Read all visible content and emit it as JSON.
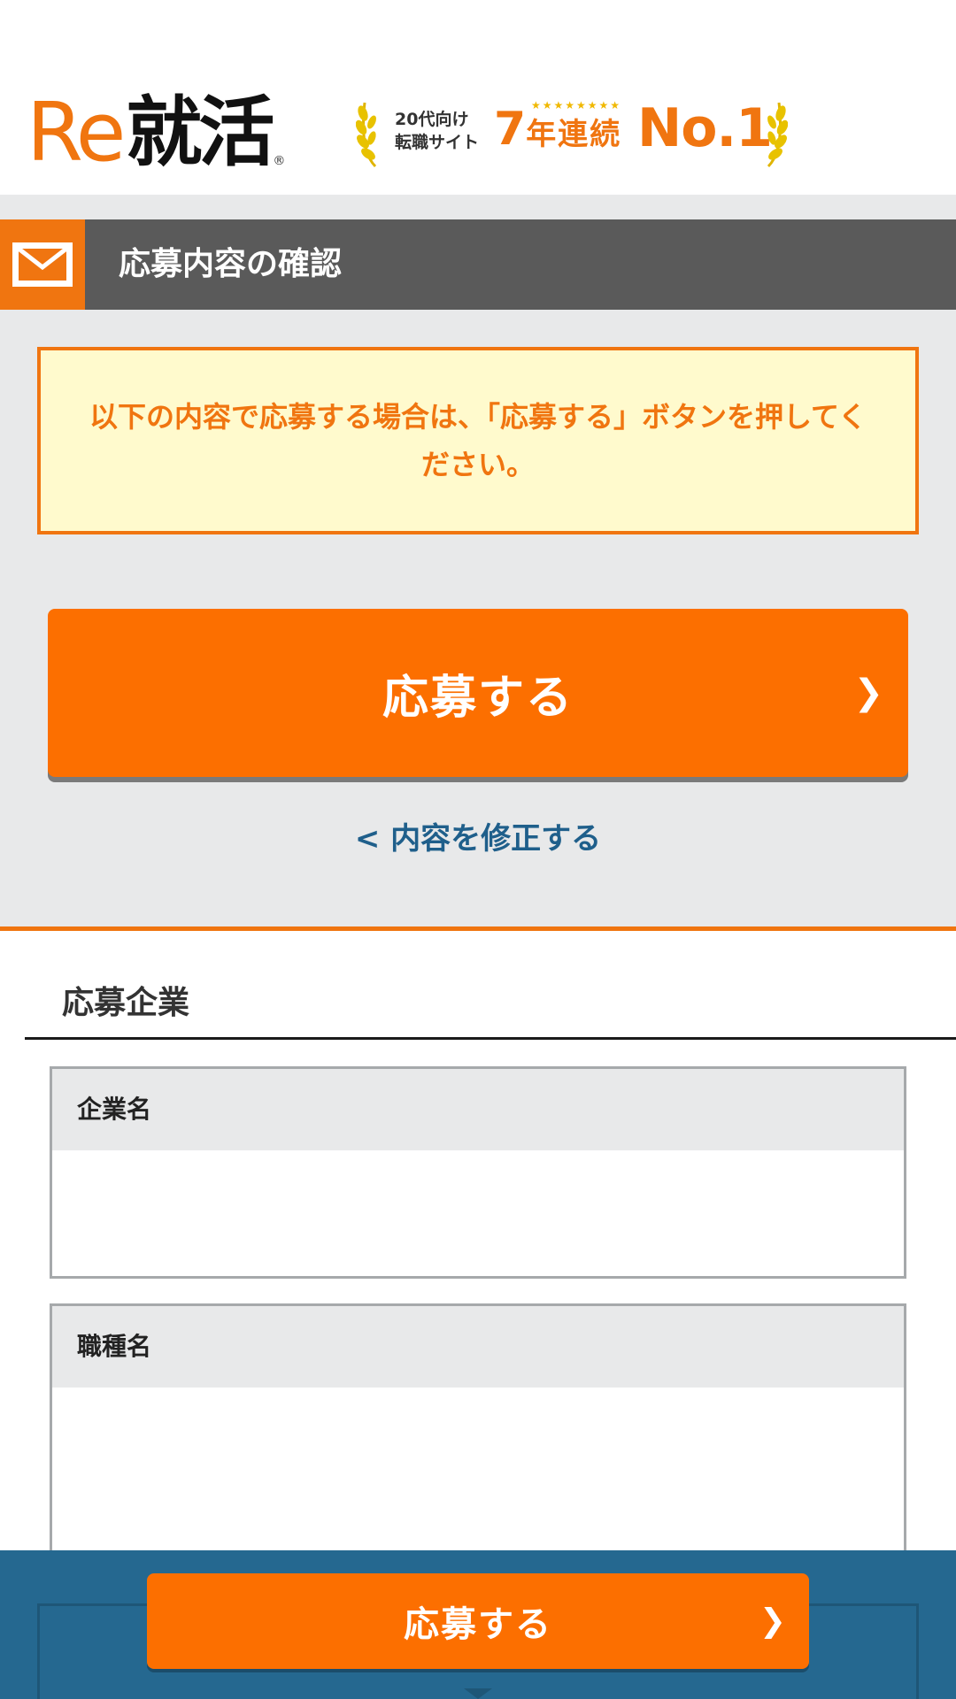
{
  "header": {
    "logo_re": "Re",
    "logo_kanji": "就活",
    "logo_reg": "®",
    "award": {
      "subtitle_line1": "20代向け",
      "subtitle_line2": "転職サイト",
      "years_num": "7",
      "years_text": "年連続",
      "stars": "★★★★★★★★",
      "rank": "No.1"
    }
  },
  "confirm": {
    "section_title": "応募内容の確認",
    "section_icon": "mail-icon",
    "notice_text": "以下の内容で応募する場合は、「応募する」ボタンを押してください。",
    "apply_label": "応募する",
    "edit_link": "< 内容を修正する"
  },
  "company_section": {
    "title": "応募企業",
    "fields": [
      {
        "label": "企業名",
        "value": ""
      },
      {
        "label": "職種名",
        "value": ""
      }
    ]
  },
  "bottom_bar": {
    "apply_label": "応募する"
  },
  "colors": {
    "accent": "#f07510",
    "button": "#fc6f00",
    "section_bar": "#5a5a5a",
    "notice_bg": "#fffacd",
    "link": "#1f5f8b",
    "bottom_bar": "#256890"
  }
}
